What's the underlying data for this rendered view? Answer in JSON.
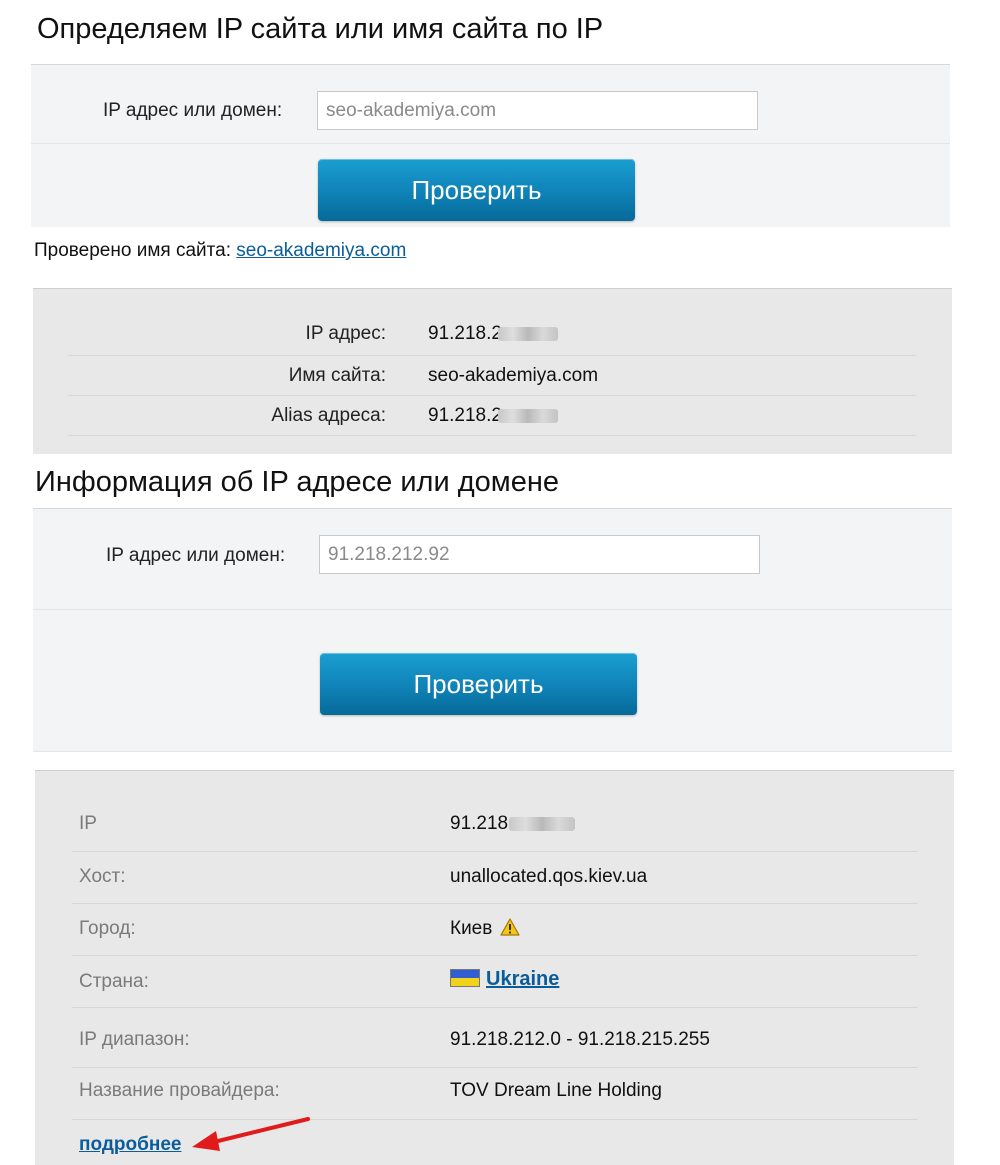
{
  "section1": {
    "title": "Определяем IP сайта или имя сайта по IP",
    "label": "IP адрес или домен:",
    "input_value": "seo-akademiya.com",
    "button": "Проверить"
  },
  "checked": {
    "prefix": "Проверено имя сайта:",
    "link": "seo-akademiya.com"
  },
  "result1": {
    "rows": [
      {
        "key": "IP адрес:",
        "value": "91.218.2"
      },
      {
        "key": "Имя сайта:",
        "value": "seo-akademiya.com"
      },
      {
        "key": "Alias адреса:",
        "value": "91.218.2"
      }
    ]
  },
  "section2": {
    "title": "Информация об IP адресе или домене",
    "label": "IP адрес или домен:",
    "input_value": "91.218.212.92",
    "button": "Проверить"
  },
  "result2": {
    "rows": [
      {
        "key": "IP",
        "value": "91.218."
      },
      {
        "key": "Хост:",
        "value": "unallocated.qos.kiev.ua"
      },
      {
        "key": "Город:",
        "value": "Киев"
      },
      {
        "key": "Страна:",
        "value": "Ukraine"
      },
      {
        "key": "IP диапазон:",
        "value": "91.218.212.0 - 91.218.215.255"
      },
      {
        "key": "Название провайдера:",
        "value": "TOV Dream Line Holding"
      }
    ],
    "more_link": "подробнее"
  },
  "icons": {
    "warning": "warning-icon",
    "flag": "ukraine-flag-icon",
    "arrow": "red-arrow-annotation"
  },
  "colors": {
    "button": "#0f82b7",
    "link": "#0a5d9a",
    "flag_blue": "#2f5fd0",
    "flag_yellow": "#f2d21b",
    "arrow": "#e11b1b"
  }
}
